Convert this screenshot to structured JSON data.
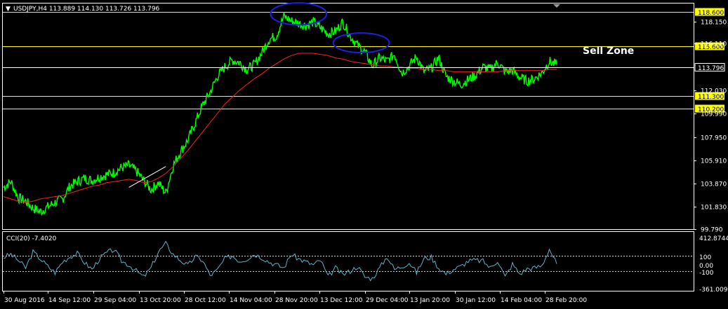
{
  "chart_data": [
    {
      "type": "line",
      "title": "USDJPY,H4  113.889 114.130 113.726 113.796",
      "symbol_menu_glyph": "▼",
      "x": [
        "30 Aug 2016",
        "14 Sep 12:00",
        "29 Sep 04:00",
        "13 Oct 20:00",
        "28 Oct 12:00",
        "14 Nov 04:00",
        "28 Nov 20:00",
        "13 Dec 12:00",
        "29 Dec 04:00",
        "13 Jan 20:00",
        "30 Jan 12:00",
        "14 Feb 04:00",
        "28 Feb 20:00"
      ],
      "y_ticks": [
        "118.150",
        "116.110",
        "113.796",
        "112.030",
        "109.990",
        "107.950",
        "105.910",
        "103.870",
        "101.830",
        "99.790"
      ],
      "ylim": [
        99.79,
        119.3
      ],
      "current_price": "113.796",
      "series": [
        {
          "name": "",
          "color": "#00ff00",
          "values": [
            103.4,
            103.9,
            102.5,
            102.2,
            101.6,
            101.3,
            101.7,
            102.1,
            102.4,
            103.5,
            103.9,
            104.2,
            104.0,
            104.3,
            104.5,
            104.7,
            105.1,
            105.3,
            104.8,
            104.0,
            103.2,
            103.8,
            102.9,
            105.3,
            106.5,
            107.5,
            109.0,
            110.5,
            111.6,
            113.0,
            113.8,
            114.4,
            114.2,
            113.6,
            114.0,
            115.0,
            116.2,
            116.5,
            118.2,
            117.8,
            117.6,
            117.4,
            117.7,
            117.2,
            116.7,
            116.9,
            117.7,
            116.5,
            115.7,
            115.1,
            113.9,
            114.6,
            114.3,
            114.9,
            113.3,
            113.9,
            114.7,
            113.4,
            113.7,
            114.6,
            113.0,
            112.6,
            112.3,
            112.7,
            113.1,
            113.8,
            113.6,
            114.2,
            113.4,
            113.5,
            112.9,
            112.6,
            112.8,
            113.3,
            114.3,
            114.0
          ]
        },
        {
          "name": "",
          "color": "#ff2020",
          "values": [
            102.6,
            102.4,
            102.2,
            102.1,
            102.2,
            102.4,
            102.5,
            102.6,
            102.7,
            102.9,
            103.1,
            103.3,
            103.5,
            103.6,
            103.8,
            103.9,
            104.0,
            104.1,
            104.0,
            103.8,
            103.9,
            104.2,
            104.6,
            105.2,
            105.9,
            106.6,
            107.4,
            108.2,
            109.0,
            109.8,
            110.6,
            111.2,
            111.8,
            112.3,
            112.8,
            113.2,
            113.7,
            114.1,
            114.5,
            114.8,
            115.0,
            115.0,
            115.0,
            114.9,
            114.8,
            114.6,
            114.5,
            114.3,
            114.2,
            114.1,
            114.0,
            113.9,
            113.9,
            113.8,
            113.8,
            113.7,
            113.7,
            113.6,
            113.6,
            113.5,
            113.5,
            113.4,
            113.4,
            113.4,
            113.4,
            113.4,
            113.4,
            113.4,
            113.5,
            113.5,
            113.5,
            113.5,
            113.5,
            113.5,
            113.6,
            113.6
          ]
        }
      ],
      "levels": [
        {
          "value": 118.6,
          "label": "118.600",
          "color": "#ffff00"
        },
        {
          "value": 115.6,
          "label": "115.600",
          "color": "#ffff00"
        },
        {
          "value": 111.3,
          "label": "111.300",
          "color": "#ffff00"
        },
        {
          "value": 110.2,
          "label": "110.200",
          "color": "#ffff00"
        }
      ],
      "annotations": [
        {
          "text": "Sell Zone"
        }
      ],
      "trendline": {
        "from": [
          17,
          103.4
        ],
        "to": [
          22,
          105.2
        ],
        "color": "#ffffff"
      },
      "ellipses": [
        {
          "cx": 40,
          "cy": 118.4,
          "rx": 3.8,
          "ry": 0.95,
          "color": "#1e1ee6"
        },
        {
          "cx": 48.5,
          "cy": 115.9,
          "rx": 3.8,
          "ry": 0.85,
          "color": "#1e1ee6"
        }
      ],
      "grid": false
    },
    {
      "type": "line",
      "title": "CCI(20) -7.4020",
      "y_ticks": [
        "412.8744",
        "100",
        "0.00",
        "-100",
        "-361.0092"
      ],
      "ylim": [
        -361.0092,
        412.8744
      ],
      "dashed_levels": [
        100,
        -100
      ],
      "series": [
        {
          "name": "",
          "color": "#5fb3c8",
          "values": [
            80,
            120,
            40,
            -60,
            150,
            60,
            -40,
            -120,
            20,
            90,
            130,
            10,
            -80,
            60,
            140,
            180,
            30,
            -20,
            -100,
            -180,
            -60,
            150,
            260,
            120,
            40,
            -30,
            90,
            40,
            -160,
            -90,
            60,
            100,
            30,
            60,
            120,
            80,
            20,
            -20,
            -60,
            120,
            60,
            20,
            -20,
            40,
            -180,
            -60,
            -150,
            -100,
            -40,
            -180,
            -200,
            -60,
            90,
            -80,
            -40,
            10,
            -120,
            60,
            80,
            -60,
            -140,
            -80,
            -40,
            30,
            40,
            30,
            -60,
            40,
            -180,
            -10,
            -140,
            -70,
            -60,
            -30,
            190,
            -7.402
          ]
        }
      ]
    }
  ]
}
